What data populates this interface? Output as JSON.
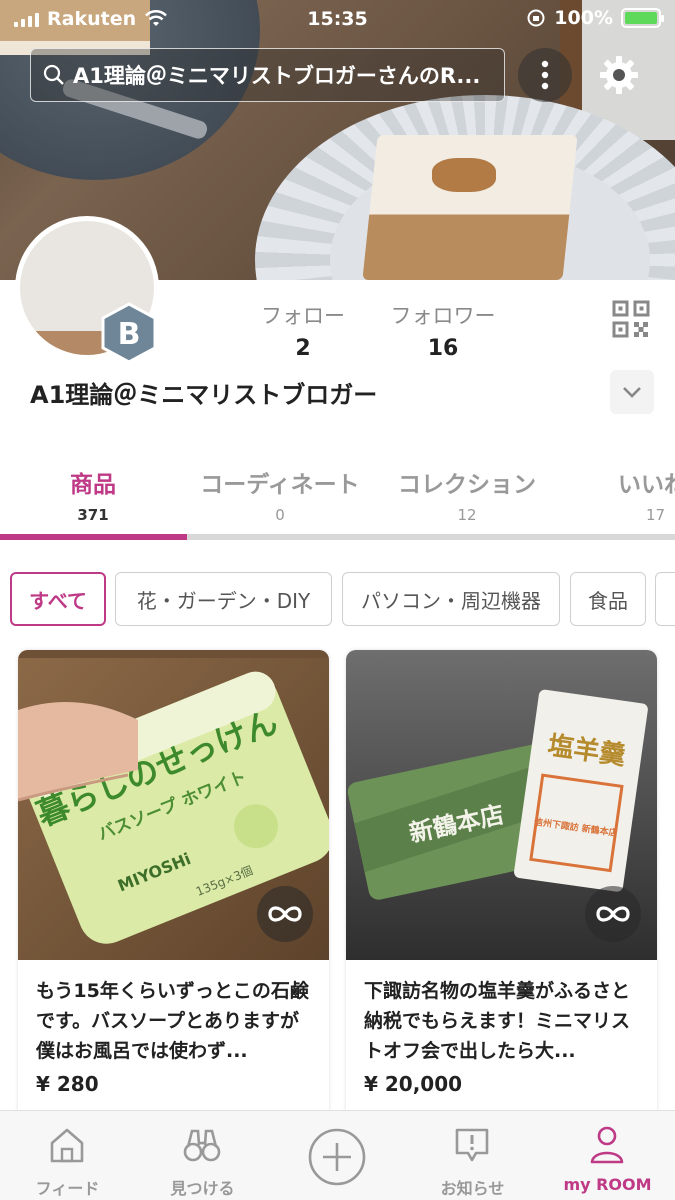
{
  "status_bar": {
    "carrier": "Rakuten",
    "time": "15:35",
    "battery": "100%"
  },
  "search": {
    "text": "A1理論＠ミニマリストブロガーさんのR..."
  },
  "profile": {
    "name": "A1理論＠ミニマリストブロガー",
    "badge_letter": "B",
    "follow": {
      "label": "フォロー",
      "value": "2"
    },
    "followers": {
      "label": "フォロワー",
      "value": "16"
    }
  },
  "tabs": [
    {
      "label": "商品",
      "count": "371"
    },
    {
      "label": "コーディネート",
      "count": "0"
    },
    {
      "label": "コレクション",
      "count": "12"
    },
    {
      "label": "いいね",
      "count": "17"
    }
  ],
  "chips": [
    "すべて",
    "花・ガーデン・DIY",
    "パソコン・周辺機器",
    "食品"
  ],
  "cards": [
    {
      "title": "もう15年くらいずっとこの石鹸です。バスソープとありますが僕はお風呂では使わず...",
      "price": "¥ 280",
      "image_text": {
        "main": "暮らしのせっけん",
        "sub": "バスソープ ホワイト",
        "brand": "MIYOSHi",
        "weight": "135g×3個"
      }
    },
    {
      "title": "下諏訪名物の塩羊羹がふるさと納税でもらえます！ミニマリストオフ会で出したら大...",
      "price": "¥ 20,000",
      "image_text": {
        "shop": "新鶴本店",
        "box_top": "塩羊羹",
        "box_stamp": "信州下諏訪 新鶴本店"
      }
    }
  ],
  "bottom_nav": [
    {
      "label": "フィード",
      "icon": "house-icon"
    },
    {
      "label": "見つける",
      "icon": "binoculars-icon"
    },
    {
      "label": "",
      "icon": "plus-circle-icon"
    },
    {
      "label": "お知らせ",
      "icon": "notification-icon"
    },
    {
      "label": "my ROOM",
      "icon": "person-icon"
    }
  ],
  "colors": {
    "accent": "#bf3a86",
    "text": "#222222",
    "muted": "#999999",
    "battery": "#5fd95a"
  }
}
